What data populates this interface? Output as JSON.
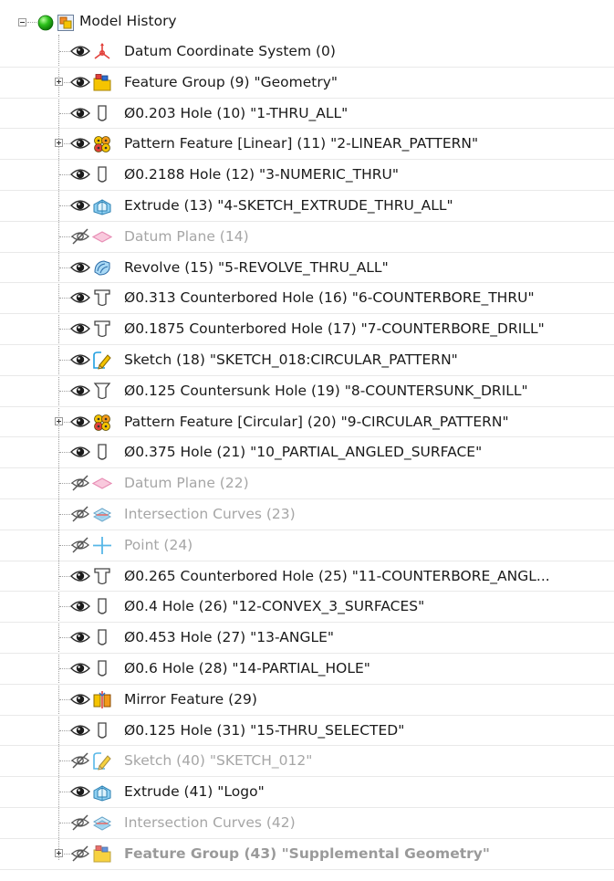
{
  "tree": {
    "root": {
      "label": "Model History",
      "status": "ok"
    },
    "items": [
      {
        "label": "Datum Coordinate System (0)",
        "icon": "datum-csys-icon",
        "visible": true,
        "hidden": false,
        "expandable": false
      },
      {
        "label": "Feature Group (9) \"Geometry\"",
        "icon": "feature-group-icon",
        "visible": true,
        "hidden": false,
        "expandable": true
      },
      {
        "label": "Ø0.203 Hole (10) \"1-THRU_ALL\"",
        "icon": "hole-icon",
        "visible": true,
        "hidden": false,
        "expandable": false
      },
      {
        "label": "Pattern Feature [Linear] (11) \"2-LINEAR_PATTERN\"",
        "icon": "pattern-icon",
        "visible": true,
        "hidden": false,
        "expandable": true
      },
      {
        "label": "Ø0.2188 Hole (12) \"3-NUMERIC_THRU\"",
        "icon": "hole-icon",
        "visible": true,
        "hidden": false,
        "expandable": false
      },
      {
        "label": "Extrude (13) \"4-SKETCH_EXTRUDE_THRU_ALL\"",
        "icon": "extrude-icon",
        "visible": true,
        "hidden": false,
        "expandable": false
      },
      {
        "label": "Datum Plane (14)",
        "icon": "datum-plane-icon",
        "visible": false,
        "hidden": true,
        "expandable": false
      },
      {
        "label": "Revolve (15) \"5-REVOLVE_THRU_ALL\"",
        "icon": "revolve-icon",
        "visible": true,
        "hidden": false,
        "expandable": false
      },
      {
        "label": "Ø0.313 Counterbored Hole (16) \"6-COUNTERBORE_THRU\"",
        "icon": "counterbore-hole-icon",
        "visible": true,
        "hidden": false,
        "expandable": false
      },
      {
        "label": "Ø0.1875 Counterbored Hole (17) \"7-COUNTERBORE_DRILL\"",
        "icon": "counterbore-hole-icon",
        "visible": true,
        "hidden": false,
        "expandable": false
      },
      {
        "label": "Sketch (18) \"SKETCH_018:CIRCULAR_PATTERN\"",
        "icon": "sketch-icon",
        "visible": true,
        "hidden": false,
        "expandable": false
      },
      {
        "label": "Ø0.125 Countersunk Hole (19) \"8-COUNTERSUNK_DRILL\"",
        "icon": "countersunk-hole-icon",
        "visible": true,
        "hidden": false,
        "expandable": false
      },
      {
        "label": "Pattern Feature [Circular] (20) \"9-CIRCULAR_PATTERN\"",
        "icon": "pattern-icon",
        "visible": true,
        "hidden": false,
        "expandable": true
      },
      {
        "label": "Ø0.375 Hole (21) \"10_PARTIAL_ANGLED_SURFACE\"",
        "icon": "hole-icon",
        "visible": true,
        "hidden": false,
        "expandable": false
      },
      {
        "label": "Datum Plane (22)",
        "icon": "datum-plane-icon",
        "visible": false,
        "hidden": true,
        "expandable": false
      },
      {
        "label": "Intersection Curves (23)",
        "icon": "intersection-curves-icon",
        "visible": false,
        "hidden": true,
        "expandable": false
      },
      {
        "label": "Point (24)",
        "icon": "point-icon",
        "visible": false,
        "hidden": true,
        "expandable": false
      },
      {
        "label": "Ø0.265 Counterbored Hole (25) \"11-COUNTERBORE_ANGL...",
        "icon": "counterbore-hole-icon",
        "visible": true,
        "hidden": false,
        "expandable": false
      },
      {
        "label": "Ø0.4 Hole (26) \"12-CONVEX_3_SURFACES\"",
        "icon": "hole-icon",
        "visible": true,
        "hidden": false,
        "expandable": false
      },
      {
        "label": "Ø0.453 Hole (27) \"13-ANGLE\"",
        "icon": "hole-icon",
        "visible": true,
        "hidden": false,
        "expandable": false
      },
      {
        "label": "Ø0.6 Hole (28) \"14-PARTIAL_HOLE\"",
        "icon": "hole-icon",
        "visible": true,
        "hidden": false,
        "expandable": false
      },
      {
        "label": "Mirror Feature (29)",
        "icon": "mirror-icon",
        "visible": true,
        "hidden": false,
        "expandable": false
      },
      {
        "label": "Ø0.125 Hole (31) \"15-THRU_SELECTED\"",
        "icon": "hole-icon",
        "visible": true,
        "hidden": false,
        "expandable": false
      },
      {
        "label": "Sketch (40) \"SKETCH_012\"",
        "icon": "sketch-icon",
        "visible": false,
        "hidden": true,
        "expandable": false
      },
      {
        "label": "Extrude (41) \"Logo\"",
        "icon": "extrude-icon",
        "visible": true,
        "hidden": false,
        "expandable": false
      },
      {
        "label": "Intersection Curves (42)",
        "icon": "intersection-curves-icon",
        "visible": false,
        "hidden": true,
        "expandable": false
      },
      {
        "label": "Feature Group (43) \"Supplemental Geometry\"",
        "icon": "feature-group-icon",
        "visible": false,
        "hidden": true,
        "suppl": true,
        "expandable": true
      }
    ]
  },
  "colors": {
    "status_ok": "#2dc21c",
    "hidden_text": "#a6a6a6",
    "sketch_blue": "#1f9fe0",
    "datum_plane_pink": "#f08ab4",
    "folder_yellow": "#f5c400"
  }
}
